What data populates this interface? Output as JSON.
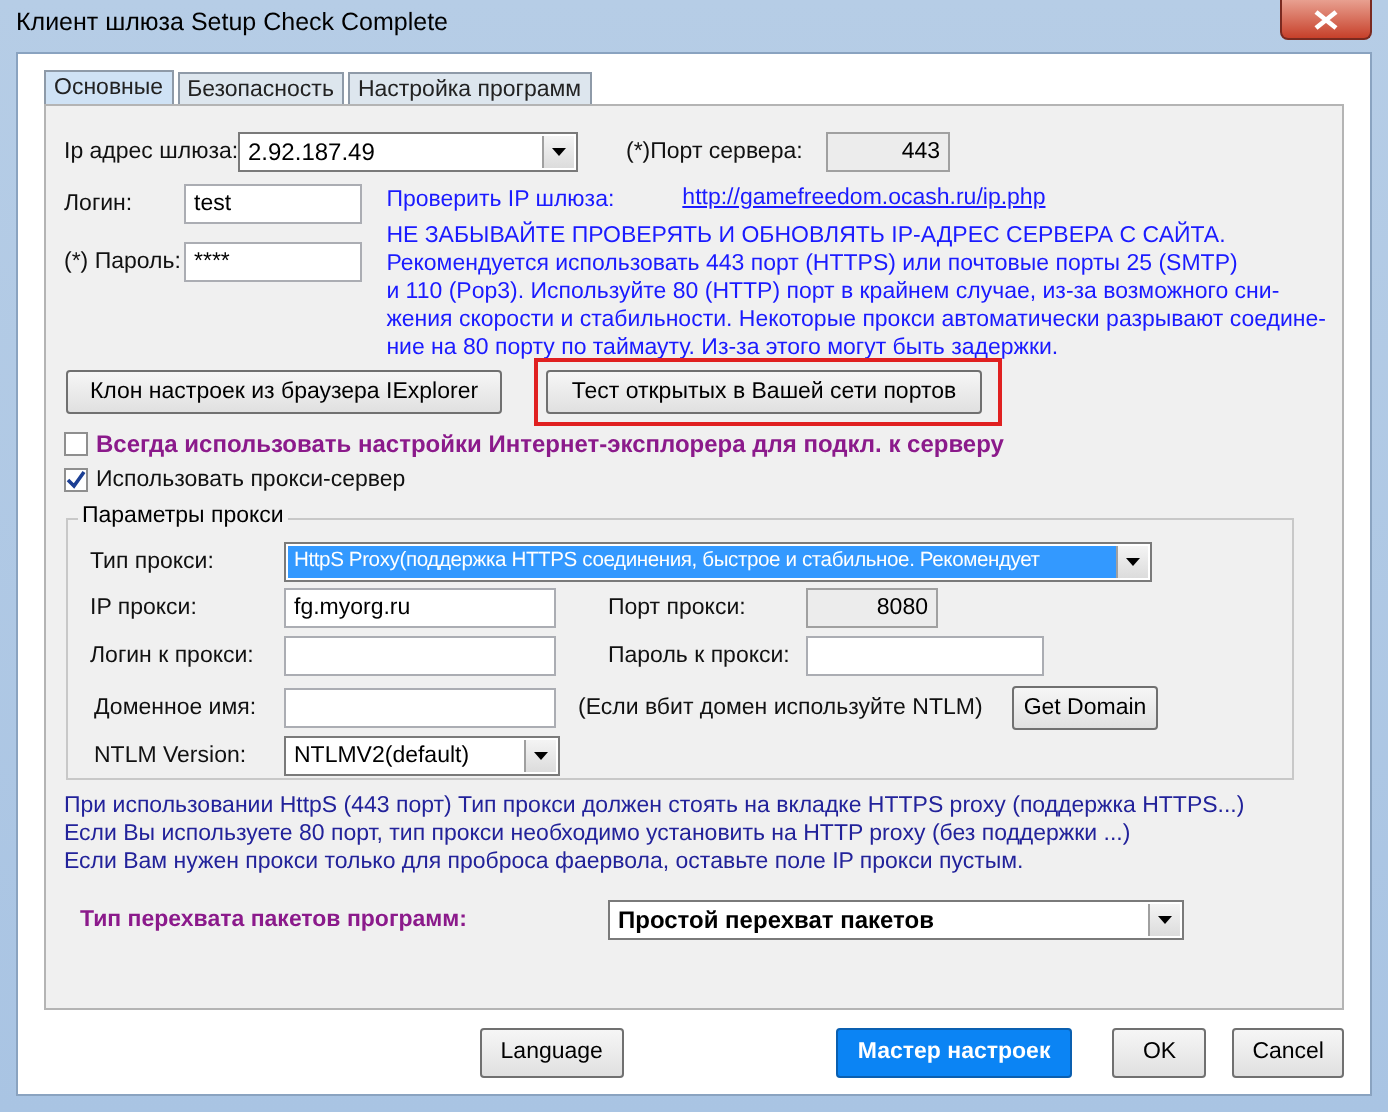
{
  "window": {
    "title": "Клиент шлюза  Setup Check Complete"
  },
  "tabs": [
    {
      "label": "Основные",
      "selected": true
    },
    {
      "label": "Безопасность",
      "selected": false
    },
    {
      "label": "Настройка программ",
      "selected": false
    }
  ],
  "gateway": {
    "ip_label": "Ip адрес шлюза:",
    "ip_value": "2.92.187.49",
    "port_label": "(*)Порт сервера:",
    "port_value": "443",
    "login_label": "Логин:",
    "login_value": "test",
    "password_label": "(*) Пароль:",
    "password_value": "****"
  },
  "check_ip": {
    "label": "Проверить IP шлюза:",
    "link": "http://gamefreedom.ocash.ru/ip.php"
  },
  "warning": {
    "heading": "НЕ ЗАБЫВАЙТЕ ПРОВЕРЯТЬ И ОБНОВЛЯТЬ IP-АДРЕС СЕРВЕРА С САЙТА.",
    "lines": [
      "Рекомендуется использовать 443 порт (HTTPS) или почтовые порты 25 (SMTP)",
      "и 110 (Pop3). Используйте 80 (HTTP) порт в крайнем случае, из-за возможного сни-",
      "жения скорости и стабильности. Некоторые прокси автоматически разрывают соедине-",
      "ние на 80 порту по таймауту. Из-за этого могут быть задержки."
    ]
  },
  "clone_button": "Клон настроек из браузера IExplorer",
  "test_button": {
    "label": "Тест открытых в Вашей сети портов",
    "highlighted": true
  },
  "checkboxes": [
    {
      "label": "Всегда использовать настройки Интернет-эксплорера для подкл. к серверу",
      "checked": false,
      "kind": "emphasis"
    },
    {
      "label": "Использовать прокси-сервер",
      "checked": true,
      "kind": "plain"
    }
  ],
  "proxy": {
    "legend": "Параметры прокси",
    "type_label": "Тип прокси:",
    "type_value": "HttpS Proxy(поддержка HTTPS соединения, быстрое и стабильное. Рекомендует",
    "ip_label": "IP прокси:",
    "ip_value": "fg.myorg.ru",
    "port_label": "Порт прокси:",
    "port_value": "8080",
    "login_label": "Логин к прокси:",
    "password_label": "Пароль к прокси:",
    "domain_label": "Доменное имя:",
    "domain_hint": "(Если вбит домен используйте NTLM)",
    "domain_button": "Get Domain",
    "ntlm_label": "NTLM Version:",
    "ntlm_value": "NTLMV2(default)"
  },
  "notes": [
    "При использовании HttpS (443 порт) Тип прокси должен стоять на вкладке HTTPS proxy (поддержка HTTPS...)",
    "Если Вы используете  80 порт, тип прокси необходимо установить на HTTP proxy (без поддержки ...)",
    "Если Вам нужен прокси только для проброса фаервола, оставьте поле IP прокси пустым."
  ],
  "capture": {
    "label": "Тип перехвата пакетов программ:",
    "value": "Простой перехват пакетов"
  },
  "buttons": [
    {
      "label": "Language",
      "kind": "normal"
    },
    {
      "label": "Мастер настроек",
      "kind": "primary"
    },
    {
      "label": "OK",
      "kind": "normal"
    },
    {
      "label": "Cancel",
      "kind": "normal"
    }
  ]
}
